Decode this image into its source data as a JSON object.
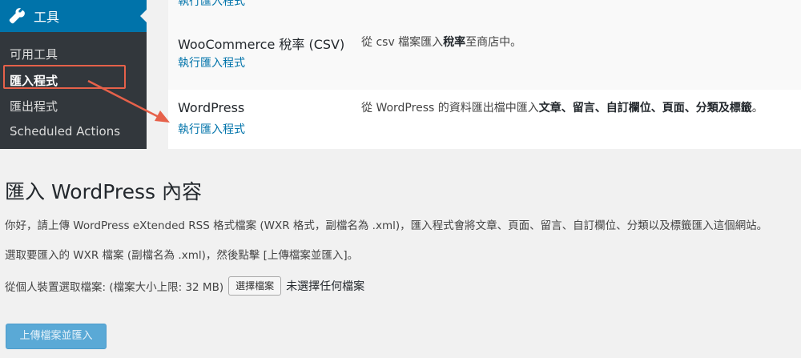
{
  "sidebar": {
    "menu_title": "工具",
    "items": [
      {
        "label": "可用工具"
      },
      {
        "label": "匯入程式"
      },
      {
        "label": "匯出程式"
      },
      {
        "label": "Scheduled Actions"
      }
    ]
  },
  "importers": {
    "cut_link": "執行匯入程式",
    "rows": [
      {
        "name": "WooCommerce 稅率 (CSV)",
        "link": "執行匯入程式",
        "desc_pre": "從 csv 檔案匯入",
        "desc_bold": "稅率",
        "desc_post": "至商店中。"
      },
      {
        "name": "WordPress",
        "link": "執行匯入程式",
        "desc_pre": "從 WordPress 的資料匯出檔中匯入",
        "desc_bold": "文章、留言、自訂欄位、頁面、分類及標籤",
        "desc_post": "。"
      }
    ]
  },
  "import_page": {
    "title": "匯入 WordPress 內容",
    "intro": "你好，請上傳 WordPress eXtended RSS 格式檔案 (WXR 格式，副檔名為 .xml)，匯入程式會將文章、頁面、留言、自訂欄位、分類以及標籤匯入這個網站。",
    "instruction": "選取要匯入的 WXR 檔案 (副檔名為 .xml)，然後點擊 [上傳檔案並匯入]。",
    "file_label": "從個人裝置選取檔案: (檔案大小上限: 32 MB)",
    "choose_button": "選擇檔案",
    "no_file": "未選擇任何檔案",
    "submit_button": "上傳檔案並匯入"
  },
  "colors": {
    "accent": "#0073aa",
    "highlight": "#e6614a"
  }
}
